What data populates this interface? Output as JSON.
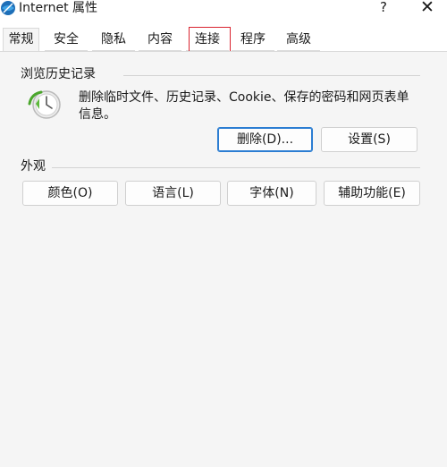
{
  "window": {
    "title": "Internet 属性",
    "help_glyph": "?",
    "close_glyph": "✕"
  },
  "tabs": [
    {
      "label": "常规",
      "active": true
    },
    {
      "label": "安全",
      "active": false
    },
    {
      "label": "隐私",
      "active": false
    },
    {
      "label": "内容",
      "active": false
    },
    {
      "label": "连接",
      "active": false,
      "highlighted": true
    },
    {
      "label": "程序",
      "active": false
    },
    {
      "label": "高级",
      "active": false
    }
  ],
  "browsing_history": {
    "title": "浏览历史记录",
    "description": "删除临时文件、历史记录、Cookie、保存的密码和网页表单信息。",
    "delete_label": "删除(D)...",
    "settings_label": "设置(S)"
  },
  "appearance": {
    "title": "外观",
    "buttons": [
      "颜色(O)",
      "语言(L)",
      "字体(N)",
      "辅助功能(E)"
    ]
  },
  "colors": {
    "accent": "#2b7dd2",
    "highlight_box": "#d9232f"
  }
}
